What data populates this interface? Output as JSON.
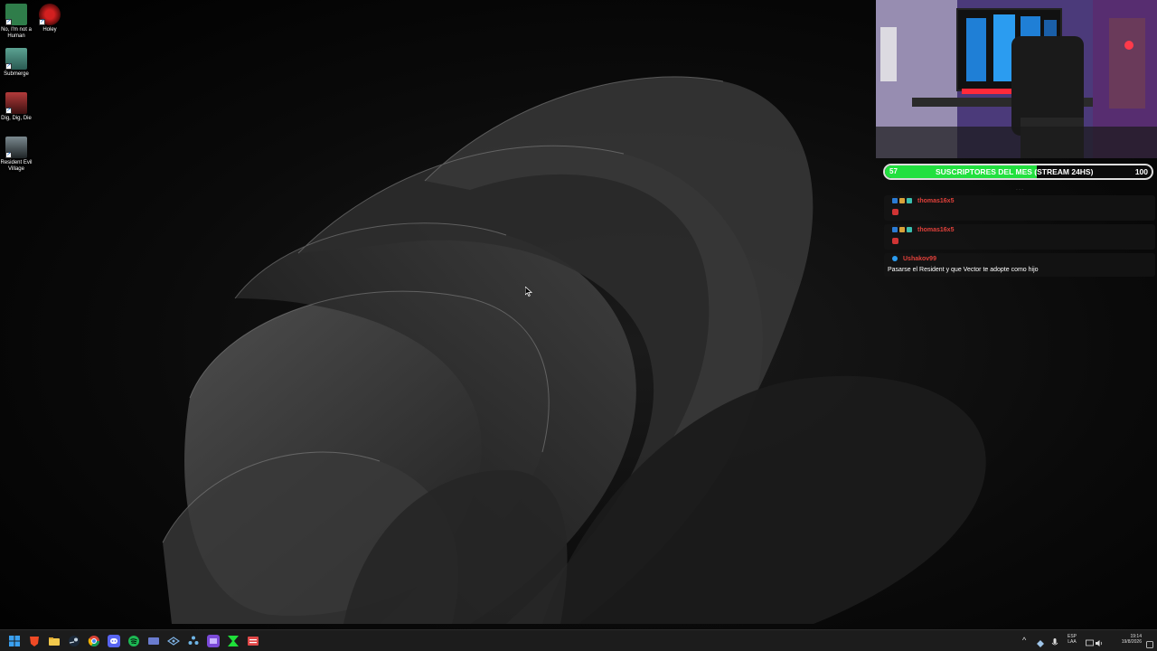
{
  "desktop": {
    "icons": [
      {
        "label": "No, I'm not a Human",
        "color": "#2f7d4a"
      },
      {
        "label": "Holey",
        "color": "#9b1b1b"
      },
      {
        "label": "Submerge",
        "color": "#3d7a6e"
      },
      {
        "label": "Dig, Dig, Die",
        "color": "#8a2b2b"
      },
      {
        "label": "Resident Evil Village",
        "color": "#4d5a60"
      }
    ]
  },
  "overlay": {
    "sub_count": "57",
    "sub_title": "SUSCRIPTORES DEL MES (STREAM 24HS)",
    "sub_goal": "100",
    "sub_progress": 0.57,
    "sub_color": "#22e03f"
  },
  "chat": {
    "messages": [
      {
        "user": "thomas16x5",
        "text": "",
        "has_emote": true
      },
      {
        "user": "thomas16x5",
        "text": "",
        "has_emote": true
      },
      {
        "user": "Ushakov99",
        "text": "Pasarse el Resident y que Vector te adopte como hijo",
        "has_emote": false
      }
    ]
  },
  "taskbar": {
    "apps": [
      "windows-start",
      "brave",
      "file-explorer",
      "steam",
      "chrome",
      "discord",
      "spotify",
      "app-blue",
      "app-network",
      "app-puzzle",
      "app-purple",
      "app-green",
      "app-red"
    ],
    "tray": {
      "lang": "ESP",
      "region": "LAA",
      "time": "19:14",
      "date": "19/8/2026"
    }
  }
}
